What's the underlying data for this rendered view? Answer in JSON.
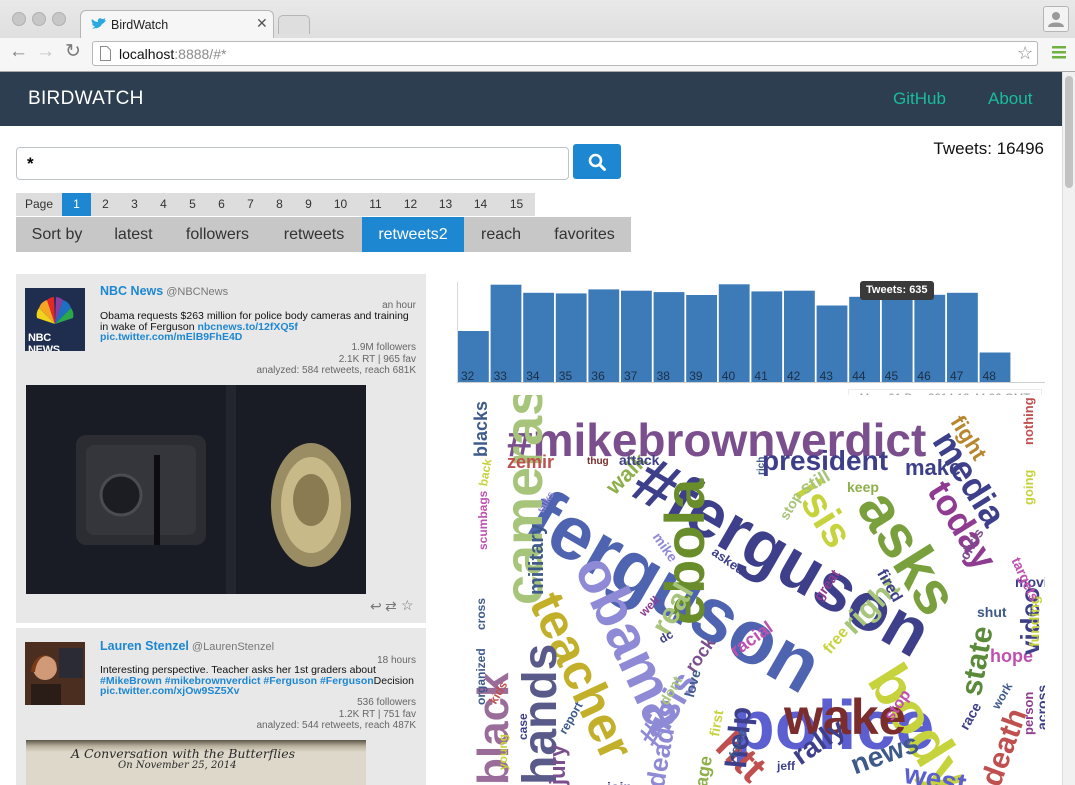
{
  "browser": {
    "tab_title": "BirdWatch",
    "url_host": "localhost",
    "url_rest": ":8888/#*"
  },
  "nav": {
    "brand": "BIRDWATCH",
    "links": [
      "GitHub",
      "About"
    ]
  },
  "search": {
    "value": "*"
  },
  "tweets_count_label": "Tweets: 16496",
  "pagination": {
    "label": "Page",
    "pages": [
      "1",
      "2",
      "3",
      "4",
      "5",
      "6",
      "7",
      "8",
      "9",
      "10",
      "11",
      "12",
      "13",
      "14",
      "15"
    ],
    "active": "1"
  },
  "sort": {
    "label": "Sort by",
    "options": [
      "latest",
      "followers",
      "retweets",
      "retweets2",
      "reach",
      "favorites"
    ],
    "active": "retweets2"
  },
  "tweets": [
    {
      "name": "NBC News",
      "handle": "@NBCNews",
      "time": "an hour",
      "text": "Obama requests $263 million for police body cameras and training in wake of Ferguson",
      "link1": "nbcnews.to/12fXQ5f",
      "link2": "pic.twitter.com/mElB9FhE4D",
      "followers": "1.9M followers",
      "rt_fav": "2.1K RT | 965 fav",
      "analyzed": "analyzed: 584 retweets, reach 681K",
      "avatar_text": "NBC NEWS"
    },
    {
      "name": "Lauren Stenzel",
      "handle": "@LaurenStenzel",
      "time": "18 hours",
      "text": "Interesting perspective. Teacher asks her 1st graders about",
      "tags": "#MikeBrown #mikebrownverdict #Ferguson #Ferguson",
      "text_end": "Decision",
      "link2": "pic.twitter.com/xjOw9SZ5Xv",
      "followers": "536 followers",
      "rt_fav": "1.2K RT | 751 fav",
      "analyzed": "analyzed: 544 retweets, reach 487K",
      "photo_text1": "A Conversation with the Butterflies",
      "photo_text2": "On November 25, 2014"
    }
  ],
  "chart_data": {
    "type": "bar",
    "categories": [
      "32",
      "33",
      "34",
      "35",
      "36",
      "37",
      "38",
      "39",
      "40",
      "41",
      "42",
      "43",
      "44",
      "45",
      "46",
      "47",
      "48"
    ],
    "values": [
      380,
      725,
      665,
      660,
      690,
      680,
      670,
      648,
      728,
      675,
      680,
      570,
      635,
      675,
      650,
      665,
      220
    ],
    "title": "",
    "xlabel": "",
    "ylabel": "",
    "ylim": [
      0,
      760
    ],
    "bar_color": "#3d7ab8",
    "tooltip": "Tweets: 635",
    "date_label": "Mon, 01 Dec 2014 19:44:00 GMT"
  },
  "wordcloud": [
    {
      "t": "#mikebrownverdict",
      "c": "#7b4e8e"
    },
    {
      "t": "#ferguson",
      "c": "#3d3f8a"
    },
    {
      "t": "ferguson",
      "c": "#4f64b0"
    },
    {
      "t": "police",
      "c": "#5b5fd0"
    },
    {
      "t": "obama",
      "c": "#8f8ad6"
    },
    {
      "t": "president",
      "c": "#3d3f8a"
    },
    {
      "t": "make",
      "c": "#3d3f8a"
    },
    {
      "t": "media",
      "c": "#3d3f8a"
    },
    {
      "t": "today",
      "c": "#8e3b91"
    },
    {
      "t": "asks",
      "c": "#7aa03e"
    },
    {
      "t": "isis",
      "c": "#c7d33c"
    },
    {
      "t": "fight",
      "c": "#b8862e"
    },
    {
      "t": "cameras",
      "c": "#a7c57a"
    },
    {
      "t": "teacher",
      "c": "#c3b02a"
    },
    {
      "t": "ebola",
      "c": "#6a8d2c"
    },
    {
      "t": "body",
      "c": "#c7d33c"
    },
    {
      "t": "wake",
      "c": "#7b2c2c"
    },
    {
      "t": "hands",
      "c": "#5a5a8a"
    },
    {
      "t": "black",
      "c": "#9a6c9a"
    },
    {
      "t": "#isis",
      "c": "#8f8ad6"
    },
    {
      "t": "right",
      "c": "#a7c57a"
    },
    {
      "t": "real",
      "c": "#a7c57a"
    },
    {
      "t": "state",
      "c": "#5a8a3a"
    },
    {
      "t": "hope",
      "c": "#c050b0"
    },
    {
      "t": "video",
      "c": "#3d3f8a"
    },
    {
      "t": "military",
      "c": "#3d5a8a"
    },
    {
      "t": "walk",
      "c": "#8db04a"
    },
    {
      "t": "news",
      "c": "#3d5a8a"
    },
    {
      "t": "rally",
      "c": "#3d3f8a"
    },
    {
      "t": "west",
      "c": "#5b5fd0"
    },
    {
      "t": "death",
      "c": "#c05050"
    },
    {
      "t": "htt",
      "c": "#c05050"
    },
    {
      "t": "help",
      "c": "#3d3f8a"
    },
    {
      "t": "blacks",
      "c": "#3d5a8a"
    },
    {
      "t": "zemir",
      "c": "#c05050"
    },
    {
      "t": "attack",
      "c": "#3d3f8a"
    },
    {
      "t": "still",
      "c": "#a7c57a"
    },
    {
      "t": "keep",
      "c": "#8db04a"
    },
    {
      "t": "fired",
      "c": "#3d3f8a"
    },
    {
      "t": "chris",
      "c": "#7b4e8e"
    },
    {
      "t": "movie",
      "c": "#3d3f8a"
    },
    {
      "t": "funding",
      "c": "#c7d33c"
    },
    {
      "t": "targets",
      "c": "#c050b0"
    },
    {
      "t": "going",
      "c": "#c7d33c"
    },
    {
      "t": "nothing",
      "c": "#c05050"
    },
    {
      "t": "racial",
      "c": "#c050b0"
    },
    {
      "t": "rock",
      "c": "#7b4e8e"
    },
    {
      "t": "free",
      "c": "#c7d33c"
    },
    {
      "t": "love",
      "c": "#3d5a8a"
    },
    {
      "t": "great",
      "c": "#8e3b91"
    },
    {
      "t": "shut",
      "c": "#3d5a8a"
    },
    {
      "t": "across",
      "c": "#3d3f8a"
    },
    {
      "t": "person",
      "c": "#8e3b91"
    },
    {
      "t": "race",
      "c": "#3d3f8a"
    },
    {
      "t": "cross",
      "c": "#3d5a8a"
    },
    {
      "t": "organized",
      "c": "#3d5a8a"
    },
    {
      "t": "scumbags",
      "c": "#c050b0"
    },
    {
      "t": "mike",
      "c": "#8f8ad6"
    },
    {
      "t": "asked",
      "c": "#3d3f8a"
    },
    {
      "t": "jury",
      "c": "#7b4e8e"
    },
    {
      "t": "dead",
      "c": "#8f8ad6"
    },
    {
      "t": "report",
      "c": "#3d5a8a"
    },
    {
      "t": "case",
      "c": "#3d3f8a"
    },
    {
      "t": "young",
      "c": "#c7d33c"
    },
    {
      "t": "kids",
      "c": "#c05050"
    },
    {
      "t": "first",
      "c": "#c7d33c"
    },
    {
      "t": "force",
      "c": "#3d5a8a"
    },
    {
      "t": "jeff",
      "c": "#3d3f8a"
    },
    {
      "t": "dont",
      "c": "#a7c57a"
    },
    {
      "t": "stop",
      "c": "#c050b0"
    },
    {
      "t": "work",
      "c": "#3d5a8a"
    },
    {
      "t": "well",
      "c": "#8e3b91"
    },
    {
      "t": "dc",
      "c": "#3d3f8a"
    },
    {
      "t": "talks",
      "c": "#8f8ad6"
    },
    {
      "t": "thug",
      "c": "#7b2c2c"
    },
    {
      "t": "rich",
      "c": "#3d5a8a"
    },
    {
      "t": "stop",
      "c": "#a7c57a"
    },
    {
      "t": "back",
      "c": "#c7d33c"
    },
    {
      "t": "join",
      "c": "#3d3f8a"
    },
    {
      "t": "age",
      "c": "#8db04a"
    }
  ]
}
